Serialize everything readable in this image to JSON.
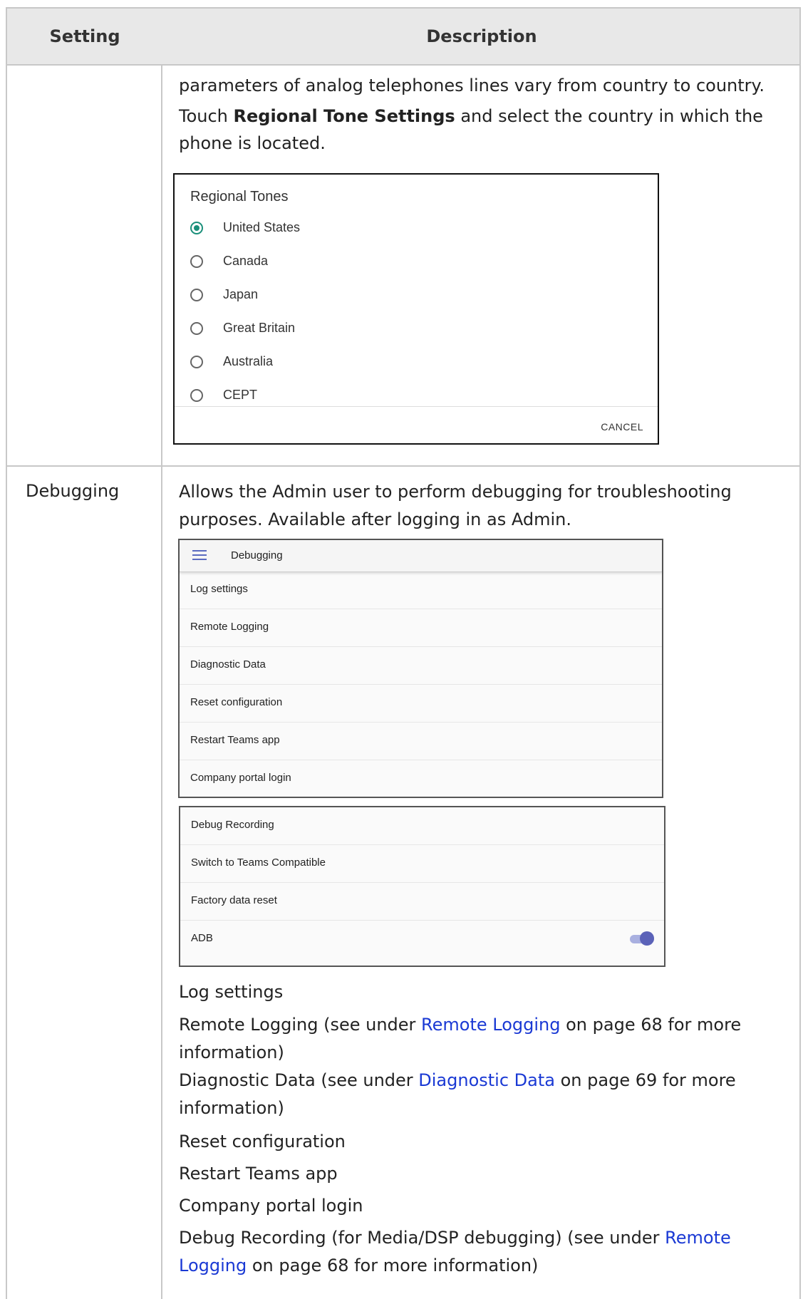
{
  "table": {
    "header": {
      "setting": "Setting",
      "description": "Description"
    }
  },
  "row1": {
    "desc_line1": "parameters of analog telephones lines vary from country to country.",
    "desc_pre": "Touch ",
    "desc_bold": "Regional Tone Settings",
    "desc_post1": " and select the country in which the",
    "desc_post2": "phone is located."
  },
  "regional_tones": {
    "title": "Regional Tones",
    "options": [
      "United States",
      "Canada",
      "Japan",
      "Great Britain",
      "Australia",
      "CEPT"
    ],
    "selected": "United States",
    "cancel_label": "CANCEL"
  },
  "row2": {
    "setting": "Debugging",
    "desc_line1": "Allows the Admin user to perform debugging for troubleshooting",
    "desc_line2": "purposes. Available after logging in as Admin."
  },
  "debug_panel": {
    "title": "Debugging",
    "items": [
      "Log settings",
      "Remote Logging",
      "Diagnostic Data",
      "Reset configuration",
      "Restart Teams app",
      "Company portal login"
    ]
  },
  "debug_panel2": {
    "items": [
      "Debug Recording",
      "Switch to Teams Compatible",
      "Factory data reset",
      "ADB"
    ],
    "adb_enabled": true,
    "toggle_color": "#5b62b8"
  },
  "list": {
    "log_settings": "Log settings",
    "remote_pre": "Remote Logging (see under ",
    "remote_link": "Remote Logging",
    "remote_post": " on page 68 for more",
    "remote_cont": "information)",
    "diag_pre": "Diagnostic Data (see under ",
    "diag_link": "Diagnostic Data",
    "diag_post": " on page 69 for more",
    "diag_cont": "information)",
    "reset_config": "Reset configuration",
    "restart_teams": "Restart Teams app",
    "company_portal": "Company portal login",
    "debug_rec_pre": "Debug Recording (for Media/DSP debugging) (see under ",
    "debug_rec_link1": "Remote",
    "debug_rec_link2": "Logging",
    "debug_rec_post": " on page 68 for more information)"
  },
  "colors": {
    "link": "#1a39d4",
    "radio_selected": "#1a8f7a",
    "header_bg": "#e8e8e8"
  }
}
